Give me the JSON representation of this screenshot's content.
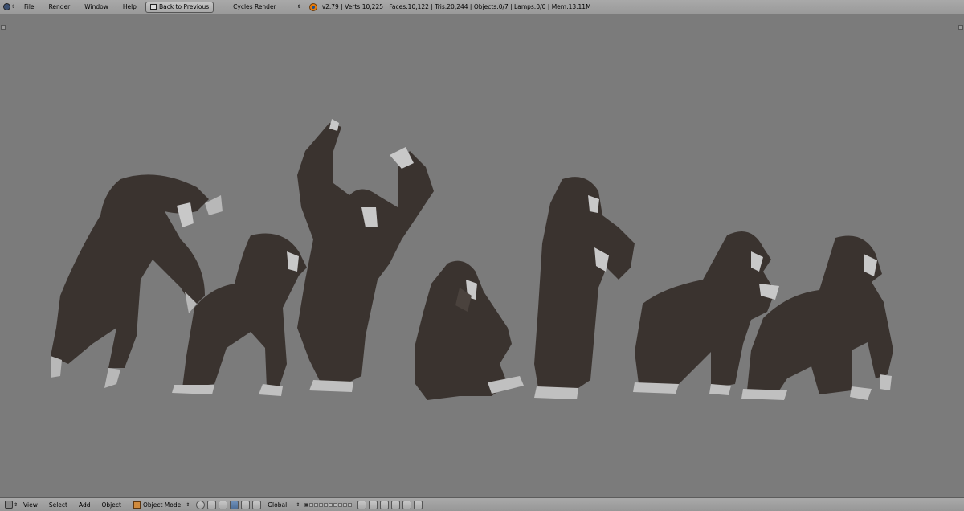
{
  "top_header": {
    "menus": [
      "File",
      "Render",
      "Window",
      "Help"
    ],
    "back_button_label": "Back to Previous",
    "render_engine": "Cycles Render",
    "stats": "v2.79 | Verts:10,225 | Faces:10,122 | Tris:20,244 | Objects:0/7 | Lamps:0/0 | Mem:13.11M"
  },
  "viewport": {
    "background_color": "#7b7b7b",
    "model_color": "#3a332f",
    "objects": [
      "gorilla-leaning",
      "gorilla-quadruped-1",
      "gorilla-arms-raised",
      "gorilla-sitting",
      "gorilla-standing",
      "gorilla-quadruped-2",
      "gorilla-quadruped-3"
    ]
  },
  "bottom_header": {
    "menus": [
      "View",
      "Select",
      "Add",
      "Object"
    ],
    "mode": "Object Mode",
    "orientation": "Global"
  }
}
